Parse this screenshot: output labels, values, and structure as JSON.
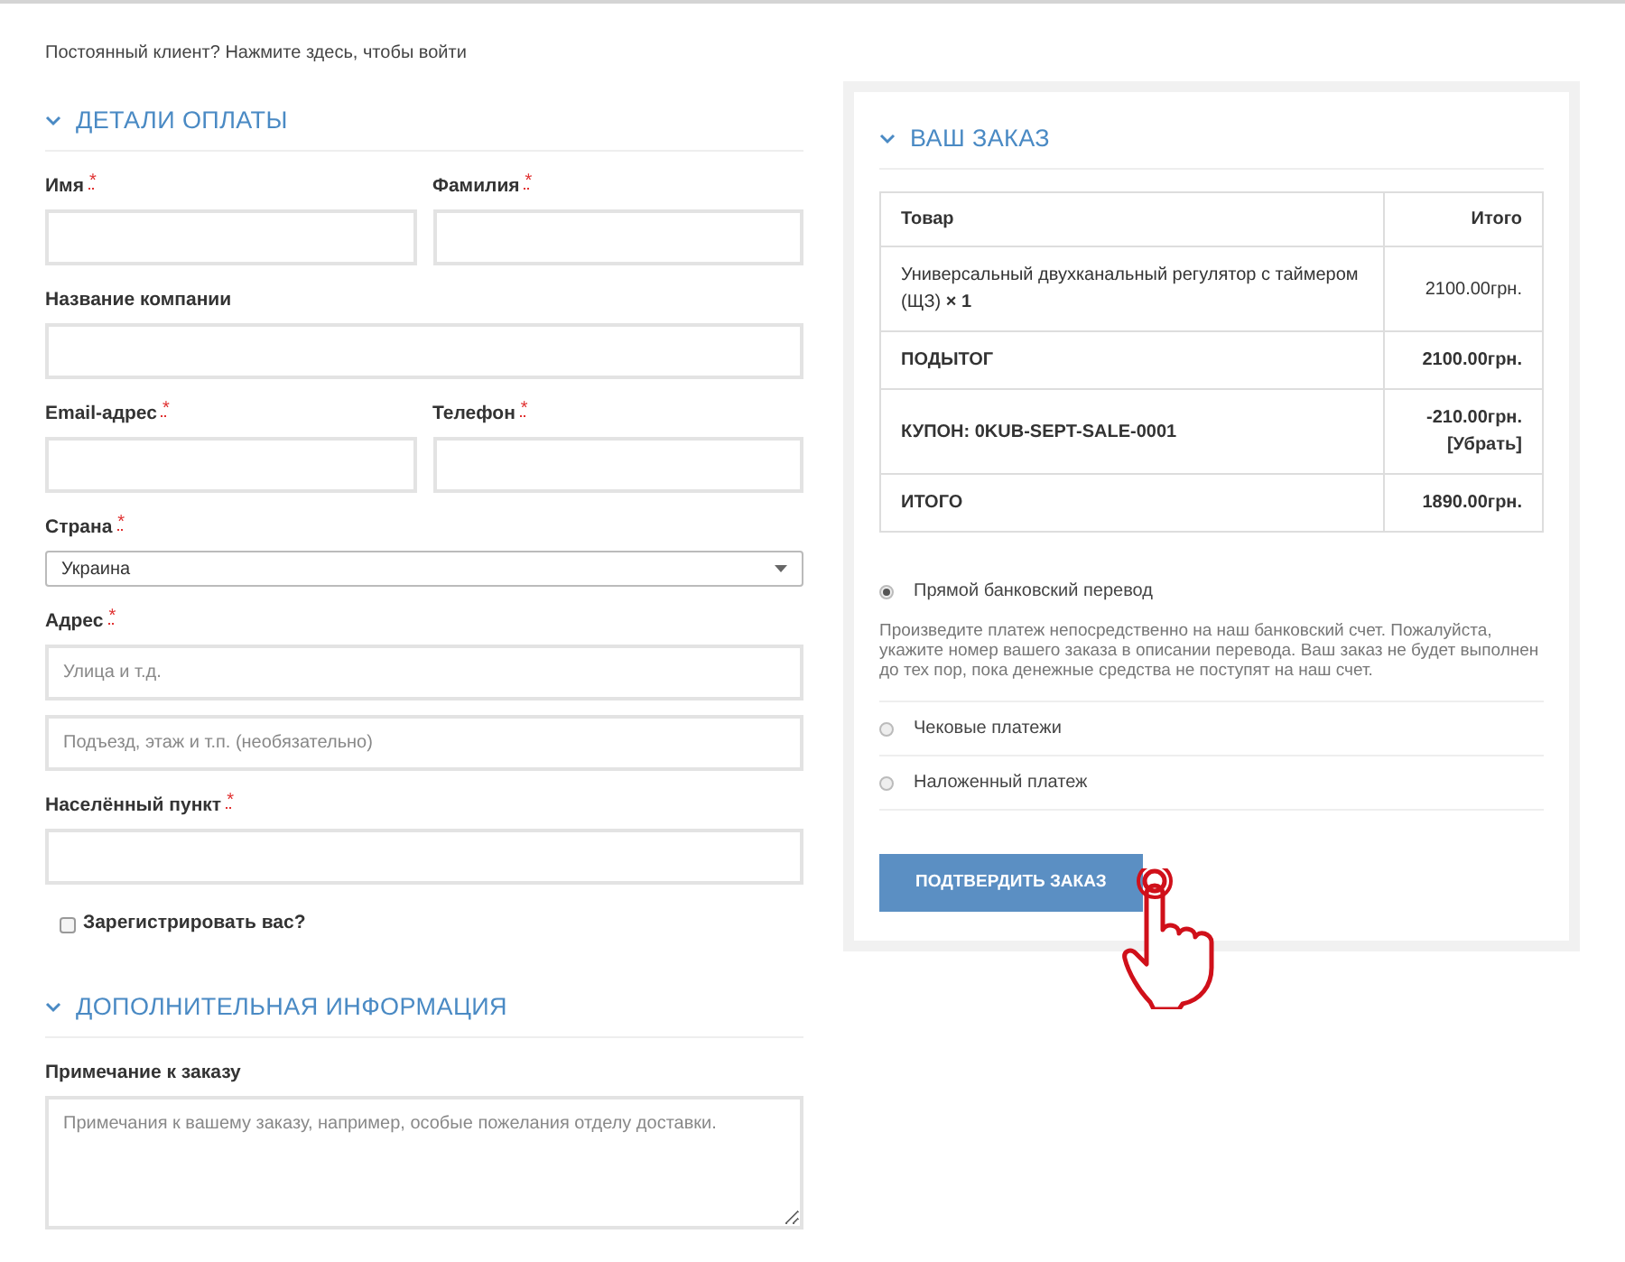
{
  "login_prompt": "Постоянный клиент? Нажмите здесь, чтобы войти",
  "billing": {
    "title": "ДЕТАЛИ ОПЛАТЫ",
    "rows": [
      [
        {
          "label": "Имя",
          "required_mark": "*",
          "kind": "text"
        },
        {
          "label": "Фамилия",
          "required_mark": "*",
          "kind": "text"
        }
      ],
      [
        {
          "label": "Название компании",
          "kind": "text"
        }
      ],
      [
        {
          "label": "Email-адрес",
          "required_mark": "*",
          "kind": "text"
        },
        {
          "label": "Телефон",
          "required_mark": "*",
          "kind": "text"
        }
      ],
      [
        {
          "label": "Страна",
          "required_mark": "*",
          "kind": "select",
          "value": "Украина"
        }
      ],
      [
        {
          "label": "Адрес",
          "required_mark": "*",
          "kind": "text",
          "placeholder": "Улица и т.д."
        }
      ],
      [
        {
          "kind": "text",
          "placeholder": "Подъезд, этаж и т.п. (необязательно)"
        }
      ],
      [
        {
          "label": "Населённый пункт",
          "required_mark": "*",
          "kind": "text"
        }
      ]
    ],
    "register": {
      "label": "Зарегистрировать вас?",
      "checked": false
    }
  },
  "additional": {
    "title": "ДОПОЛНИТЕЛЬНАЯ ИНФОРМАЦИЯ",
    "field": {
      "label": "Примечание к заказу",
      "kind": "textarea",
      "placeholder": "Примечания к вашему заказу, например, особые пожелания отделу доставки."
    }
  },
  "order": {
    "title": "ВАШ ЗАКАЗ",
    "columns": [
      "Товар",
      "Итого"
    ],
    "rows": [
      {
        "kind": "item",
        "label": "Универсальный двухканальный регулятор с таймером (ЩЗ) **× 1**",
        "amount": "2100.00грн."
      },
      {
        "kind": "total",
        "label": "ПОДЫТОГ",
        "amount": "2100.00грн."
      },
      {
        "kind": "total",
        "label": "КУПОН: 0KUB-SEPT-SALE-0001",
        "amount": "-210.00грн.",
        "remove_link": "[Убрать]"
      },
      {
        "kind": "total",
        "label": "ИТОГО",
        "amount": "1890.00грн."
      }
    ],
    "payment_methods": [
      {
        "label": "Прямой банковский перевод",
        "selected": true,
        "description": "Произведите платеж непосредственно на наш банковский счет. Пожалуйста, укажите номер вашего заказа в описании перевода. Ваш заказ не будет выполнен до тех пор, пока денежные средства не поступят на наш счет."
      },
      {
        "label": "Чековые платежи",
        "selected": false
      },
      {
        "label": "Наложенный платеж",
        "selected": false
      }
    ],
    "submit": "ПОДТВЕРДИТЬ ЗАКАЗ"
  }
}
